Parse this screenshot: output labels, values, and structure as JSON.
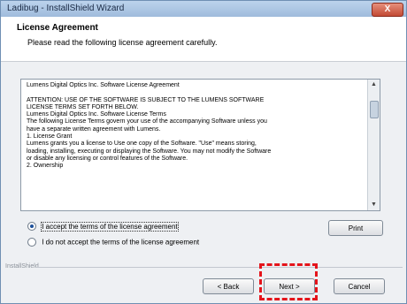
{
  "window": {
    "title": "Ladibug - InstallShield Wizard",
    "close_label": "X"
  },
  "header": {
    "title": "License Agreement",
    "subtitle": "Please read the following license agreement carefully."
  },
  "license": {
    "lines": [
      "Lumens Digital Optics Inc. Software License Agreement",
      "",
      "ATTENTION: USE OF THE SOFTWARE IS SUBJECT TO THE LUMENS SOFTWARE",
      "LICENSE TERMS SET FORTH BELOW.",
      "Lumens Digital Optics Inc. Software License Terms",
      "The following License Terms govern your use of the accompanying Software unless you",
      "have a separate written agreement with Lumens.",
      "1. License Grant",
      "Lumens grants you a license to Use one copy of the Software. \"Use\" means storing,",
      "loading, installing, executing or displaying the Software. You may not modify the Software",
      "or disable any licensing or control features of the Software.",
      "2. Ownership"
    ]
  },
  "options": {
    "accept_label": "I accept the terms of the license agreement",
    "decline_label": "I do not accept the terms of the license agreement",
    "selected": "accept"
  },
  "buttons": {
    "print": "Print",
    "back": "< Back",
    "next": "Next >",
    "cancel": "Cancel"
  },
  "footer": {
    "brand": "InstallShield"
  },
  "colors": {
    "highlight": "#e4141b",
    "titlebar": "#9fbbdc"
  }
}
